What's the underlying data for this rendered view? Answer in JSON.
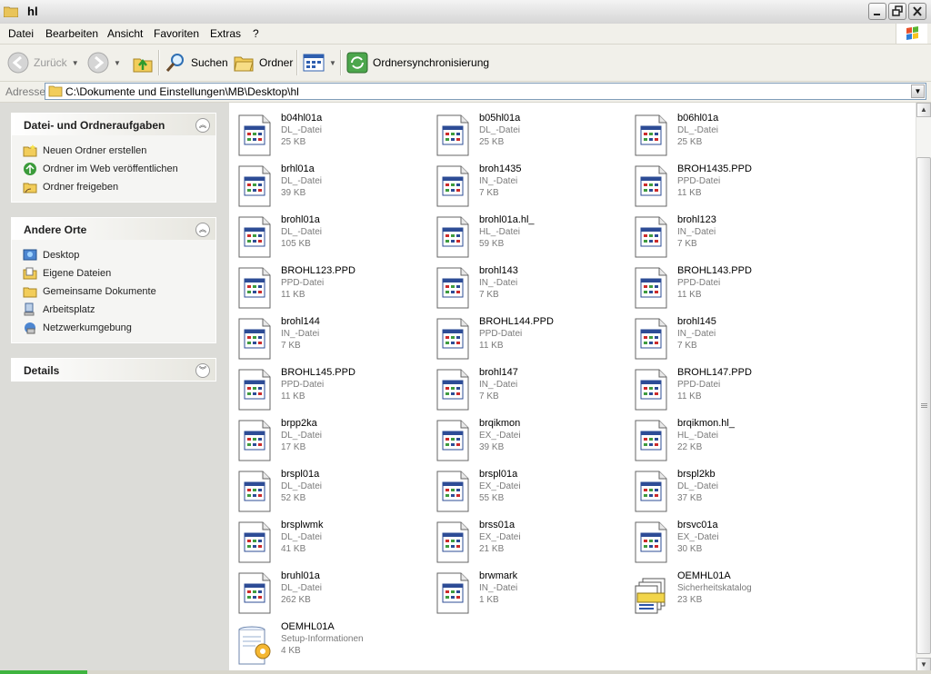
{
  "window": {
    "title": "hl"
  },
  "menu": [
    "Datei",
    "Bearbeiten",
    "Ansicht",
    "Favoriten",
    "Extras",
    "?"
  ],
  "toolbar": {
    "back": "Zurück",
    "search": "Suchen",
    "folders": "Ordner",
    "sync": "Ordnersynchronisierung"
  },
  "address": {
    "label": "Adresse",
    "path": "C:\\Dokumente und Einstellungen\\MB\\Desktop\\hl"
  },
  "tasks": {
    "file_folder": {
      "title": "Datei- und Ordneraufgaben",
      "items": [
        "Neuen Ordner erstellen",
        "Ordner im Web veröffentlichen",
        "Ordner freigeben"
      ]
    },
    "other_places": {
      "title": "Andere Orte",
      "items": [
        "Desktop",
        "Eigene Dateien",
        "Gemeinsame Dokumente",
        "Arbeitsplatz",
        "Netzwerkumgebung"
      ]
    },
    "details": {
      "title": "Details"
    }
  },
  "files": [
    {
      "name": "b04hl01a",
      "type": "DL_-Datei",
      "size": "25 KB",
      "icon": "generic-file-icon"
    },
    {
      "name": "b05hl01a",
      "type": "DL_-Datei",
      "size": "25 KB",
      "icon": "generic-file-icon"
    },
    {
      "name": "b06hl01a",
      "type": "DL_-Datei",
      "size": "25 KB",
      "icon": "generic-file-icon"
    },
    {
      "name": "brhl01a",
      "type": "DL_-Datei",
      "size": "39 KB",
      "icon": "generic-file-icon"
    },
    {
      "name": "broh1435",
      "type": "IN_-Datei",
      "size": "7 KB",
      "icon": "generic-file-icon"
    },
    {
      "name": "BROH1435.PPD",
      "type": "PPD-Datei",
      "size": "11 KB",
      "icon": "generic-file-icon"
    },
    {
      "name": "brohl01a",
      "type": "DL_-Datei",
      "size": "105 KB",
      "icon": "generic-file-icon"
    },
    {
      "name": "brohl01a.hl_",
      "type": "HL_-Datei",
      "size": "59 KB",
      "icon": "generic-file-icon"
    },
    {
      "name": "brohl123",
      "type": "IN_-Datei",
      "size": "7 KB",
      "icon": "generic-file-icon"
    },
    {
      "name": "BROHL123.PPD",
      "type": "PPD-Datei",
      "size": "11 KB",
      "icon": "generic-file-icon"
    },
    {
      "name": "brohl143",
      "type": "IN_-Datei",
      "size": "7 KB",
      "icon": "generic-file-icon"
    },
    {
      "name": "BROHL143.PPD",
      "type": "PPD-Datei",
      "size": "11 KB",
      "icon": "generic-file-icon"
    },
    {
      "name": "brohl144",
      "type": "IN_-Datei",
      "size": "7 KB",
      "icon": "generic-file-icon"
    },
    {
      "name": "BROHL144.PPD",
      "type": "PPD-Datei",
      "size": "11 KB",
      "icon": "generic-file-icon"
    },
    {
      "name": "brohl145",
      "type": "IN_-Datei",
      "size": "7 KB",
      "icon": "generic-file-icon"
    },
    {
      "name": "BROHL145.PPD",
      "type": "PPD-Datei",
      "size": "11 KB",
      "icon": "generic-file-icon"
    },
    {
      "name": "brohl147",
      "type": "IN_-Datei",
      "size": "7 KB",
      "icon": "generic-file-icon"
    },
    {
      "name": "BROHL147.PPD",
      "type": "PPD-Datei",
      "size": "11 KB",
      "icon": "generic-file-icon"
    },
    {
      "name": "brpp2ka",
      "type": "DL_-Datei",
      "size": "17 KB",
      "icon": "generic-file-icon"
    },
    {
      "name": "brqikmon",
      "type": "EX_-Datei",
      "size": "39 KB",
      "icon": "generic-file-icon"
    },
    {
      "name": "brqikmon.hl_",
      "type": "HL_-Datei",
      "size": "22 KB",
      "icon": "generic-file-icon"
    },
    {
      "name": "brspl01a",
      "type": "DL_-Datei",
      "size": "52 KB",
      "icon": "generic-file-icon"
    },
    {
      "name": "brspl01a",
      "type": "EX_-Datei",
      "size": "55 KB",
      "icon": "generic-file-icon"
    },
    {
      "name": "brspl2kb",
      "type": "DL_-Datei",
      "size": "37 KB",
      "icon": "generic-file-icon"
    },
    {
      "name": "brsplwmk",
      "type": "DL_-Datei",
      "size": "41 KB",
      "icon": "generic-file-icon"
    },
    {
      "name": "brss01a",
      "type": "EX_-Datei",
      "size": "21 KB",
      "icon": "generic-file-icon"
    },
    {
      "name": "brsvc01a",
      "type": "EX_-Datei",
      "size": "30 KB",
      "icon": "generic-file-icon"
    },
    {
      "name": "bruhl01a",
      "type": "DL_-Datei",
      "size": "262 KB",
      "icon": "generic-file-icon"
    },
    {
      "name": "brwmark",
      "type": "IN_-Datei",
      "size": "1 KB",
      "icon": "generic-file-icon"
    },
    {
      "name": "OEMHL01A",
      "type": "Sicherheitskatalog",
      "size": "23 KB",
      "icon": "security-catalog-icon"
    },
    {
      "name": "OEMHL01A",
      "type": "Setup-Informationen",
      "size": "4 KB",
      "icon": "setup-info-icon"
    }
  ]
}
